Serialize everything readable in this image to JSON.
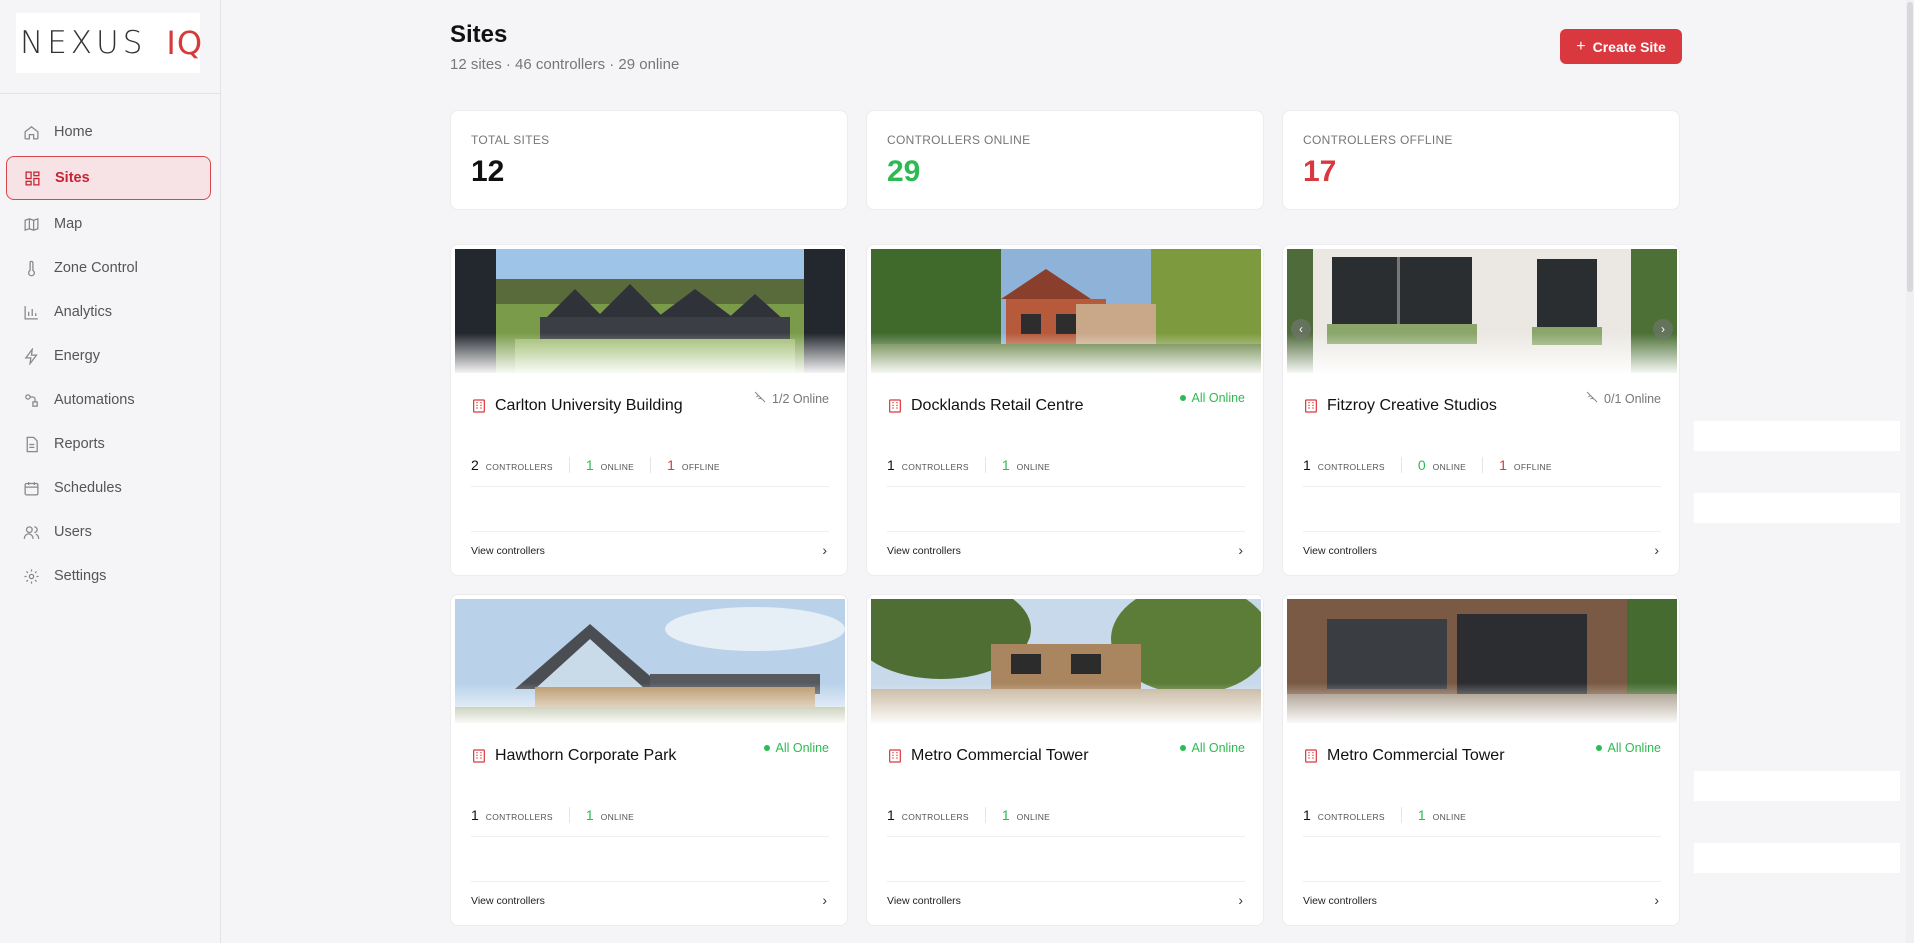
{
  "brand": {
    "name_left": "NEXUS",
    "name_right": "IQ"
  },
  "sidebar": {
    "items": [
      {
        "label": "Home",
        "icon": "home-icon",
        "active": false
      },
      {
        "label": "Sites",
        "icon": "grid-icon",
        "active": true
      },
      {
        "label": "Map",
        "icon": "map-icon",
        "active": false
      },
      {
        "label": "Zone Control",
        "icon": "thermometer-icon",
        "active": false
      },
      {
        "label": "Analytics",
        "icon": "bar-chart-icon",
        "active": false
      },
      {
        "label": "Energy",
        "icon": "lightning-icon",
        "active": false
      },
      {
        "label": "Automations",
        "icon": "automation-icon",
        "active": false
      },
      {
        "label": "Reports",
        "icon": "document-icon",
        "active": false
      },
      {
        "label": "Schedules",
        "icon": "calendar-icon",
        "active": false
      },
      {
        "label": "Users",
        "icon": "users-icon",
        "active": false
      },
      {
        "label": "Settings",
        "icon": "gear-icon",
        "active": false
      }
    ]
  },
  "header": {
    "title": "Sites",
    "subtitle": "12 sites · 46 controllers · 29 online",
    "create_label": "Create Site",
    "create_icon": "plus-icon"
  },
  "stats": [
    {
      "label": "TOTAL SITES",
      "value": "12",
      "color": "#111111"
    },
    {
      "label": "CONTROLLERS ONLINE",
      "value": "29",
      "color": "#2eba52"
    },
    {
      "label": "CONTROLLERS OFFLINE",
      "value": "17",
      "color": "#d9383f"
    }
  ],
  "cards": [
    {
      "name": "Carlton University Building",
      "status": "1/2 Online",
      "status_type": "partial",
      "metrics": {
        "controllers": "2",
        "online": "1",
        "offline": "1"
      },
      "labels": {
        "controllers": "CONTROLLERS",
        "online": "ONLINE",
        "offline": "OFFLINE"
      },
      "link": "View controllers"
    },
    {
      "name": "Docklands Retail Centre",
      "status": "All Online",
      "status_type": "online",
      "metrics": {
        "controllers": "1",
        "online": "1"
      },
      "labels": {
        "controllers": "CONTROLLERS",
        "online": "ONLINE"
      },
      "link": "View controllers"
    },
    {
      "name": "Fitzroy Creative Studios",
      "status": "0/1 Online",
      "status_type": "partial",
      "metrics": {
        "controllers": "1",
        "online": "0",
        "offline": "1"
      },
      "labels": {
        "controllers": "CONTROLLERS",
        "online": "ONLINE",
        "offline": "OFFLINE"
      },
      "link": "View controllers"
    },
    {
      "name": "Hawthorn Corporate Park",
      "status": "All Online",
      "status_type": "online",
      "metrics": {
        "controllers": "1",
        "online": "1"
      },
      "labels": {
        "controllers": "CONTROLLERS",
        "online": "ONLINE"
      },
      "link": "View controllers"
    },
    {
      "name": "Metro Commercial Tower",
      "status": "All Online",
      "status_type": "online",
      "metrics": {
        "controllers": "1",
        "online": "1"
      },
      "labels": {
        "controllers": "CONTROLLERS",
        "online": "ONLINE"
      },
      "link": "View controllers"
    },
    {
      "name": "Metro Commercial Tower",
      "status": "All Online",
      "status_type": "online",
      "metrics": {
        "controllers": "1",
        "online": "1"
      },
      "labels": {
        "controllers": "CONTROLLERS",
        "online": "ONLINE"
      },
      "link": "View controllers"
    }
  ],
  "colors": {
    "accent": "#d9383f",
    "online": "#2eba52",
    "offline": "#d9383f"
  }
}
